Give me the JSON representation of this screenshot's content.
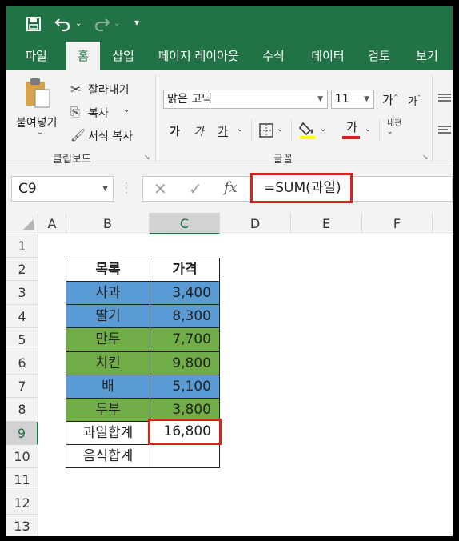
{
  "titlebar": {
    "save_icon": "save-icon",
    "undo_icon": "undo-icon",
    "redo_icon": "redo-icon",
    "customize_icon": "customize-quick-access-icon"
  },
  "tabs": [
    "파일",
    "홈",
    "삽입",
    "페이지 레이아웃",
    "수식",
    "데이터",
    "검토",
    "보기"
  ],
  "active_tab": "홈",
  "clipboard": {
    "paste": "붙여넣기",
    "cut": "잘라내기",
    "copy": "복사",
    "format_painter": "서식 복사",
    "group": "클립보드"
  },
  "font": {
    "name": "맑은 고딕",
    "size": "11",
    "grow": "가",
    "shrink": "가",
    "bold": "가",
    "italic": "가",
    "underline": "가",
    "font_color": "가",
    "phonetic": "내천",
    "group": "글꼴"
  },
  "formula_bar": {
    "name_box": "C9",
    "fx": "fx",
    "formula": "=SUM(과일)"
  },
  "columns": [
    "A",
    "B",
    "C",
    "D",
    "E",
    "F"
  ],
  "rows": [
    "1",
    "2",
    "3",
    "4",
    "5",
    "6",
    "7",
    "8",
    "9",
    "10",
    "11",
    "12",
    "13"
  ],
  "selected": {
    "column": "C",
    "row": "9"
  },
  "table": {
    "header": {
      "item": "목록",
      "price": "가격"
    },
    "rows": [
      {
        "item": "사과",
        "price": "3,400",
        "fill": "blue"
      },
      {
        "item": "딸기",
        "price": "8,300",
        "fill": "blue"
      },
      {
        "item": "만두",
        "price": "7,700",
        "fill": "green"
      },
      {
        "item": "치킨",
        "price": "9,800",
        "fill": "green"
      },
      {
        "item": "배",
        "price": "5,100",
        "fill": "blue"
      },
      {
        "item": "두부",
        "price": "3,800",
        "fill": "green"
      }
    ],
    "fruit_total_label": "과일합계",
    "fruit_total_value": "16,800",
    "food_total_label": "음식합계",
    "food_total_value": ""
  },
  "colors": {
    "excel_green": "#217346",
    "highlight_red": "#d9231d",
    "blue": "#5b9bd5",
    "green": "#70ad47"
  }
}
